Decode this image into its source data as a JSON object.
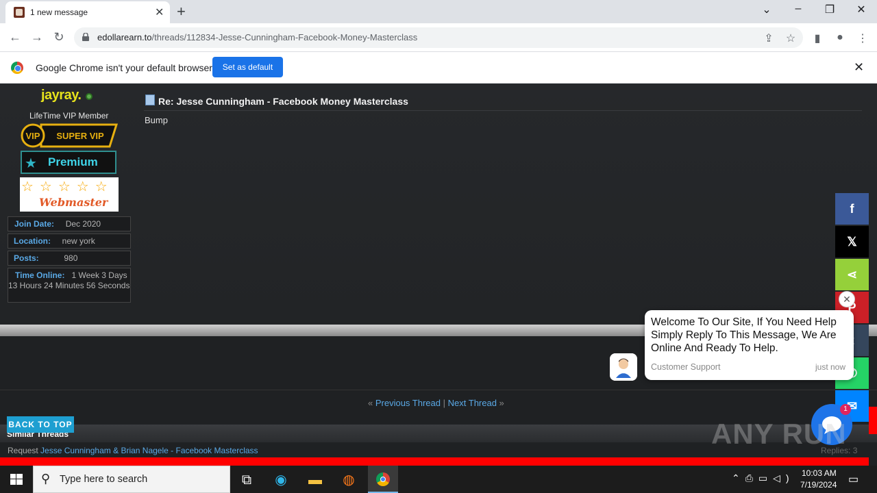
{
  "browser": {
    "tab_title": "1 new message",
    "url_domain": "edollarearn.to",
    "url_path": "/threads/112834-Jesse-Cunningham-Facebook-Money-Masterclass",
    "infobar_text": "Google Chrome isn't your default browser",
    "set_default_label": "Set as default"
  },
  "user": {
    "name": "jayray.",
    "title": "LifeTime VIP Member",
    "vip_left": "VIP",
    "vip_right": "SUPER VIP",
    "premium_label": "Premium",
    "webmaster_label": "Webmaster",
    "stats": [
      {
        "label": "Join Date:",
        "value": "Dec 2020"
      },
      {
        "label": "Location:",
        "value": "new york"
      },
      {
        "label": "Posts:",
        "value": "980"
      },
      {
        "label": "Time Online:",
        "value": "1 Week 3 Days 13 Hours 24 Minutes 56 Seconds"
      }
    ]
  },
  "post": {
    "title": "Re: Jesse Cunningham - Facebook Money Masterclass",
    "body": "Bump"
  },
  "thread_nav": {
    "prev": "Previous Thread",
    "separator": "|",
    "next": "Next Thread"
  },
  "back_to_top": "BACK TO TOP",
  "similar": {
    "title": "Similar Threads",
    "row_prefix": "Request",
    "row_link": "Jesse Cunningham & Brian Nagele - Facebook Masterclass",
    "row_replies": "Replies: 3"
  },
  "chat": {
    "message": "Welcome To Our Site, If You Need Help Simply Reply To This Message, We Are Online And Ready To Help.",
    "sender": "Customer Support",
    "time": "just now",
    "badge_count": "1"
  },
  "share_buttons": [
    {
      "icon": "facebook-icon",
      "glyph": "f",
      "color": "#3b5998"
    },
    {
      "icon": "x-icon",
      "glyph": "𝕏",
      "color": "#000000"
    },
    {
      "icon": "share-icon",
      "glyph": "⋖",
      "color": "#95d03a"
    },
    {
      "icon": "pinterest-icon",
      "glyph": "P",
      "color": "#cb2027"
    },
    {
      "icon": "tumblr-icon",
      "glyph": "t",
      "color": "#35465c"
    },
    {
      "icon": "whatsapp-icon",
      "glyph": "✆",
      "color": "#25d366"
    },
    {
      "icon": "messenger-icon",
      "glyph": "✉",
      "color": "#0084ff"
    }
  ],
  "watermark": "ANY RUN",
  "taskbar": {
    "search_placeholder": "Type here to search",
    "time": "10:03 AM",
    "date": "7/19/2024"
  }
}
